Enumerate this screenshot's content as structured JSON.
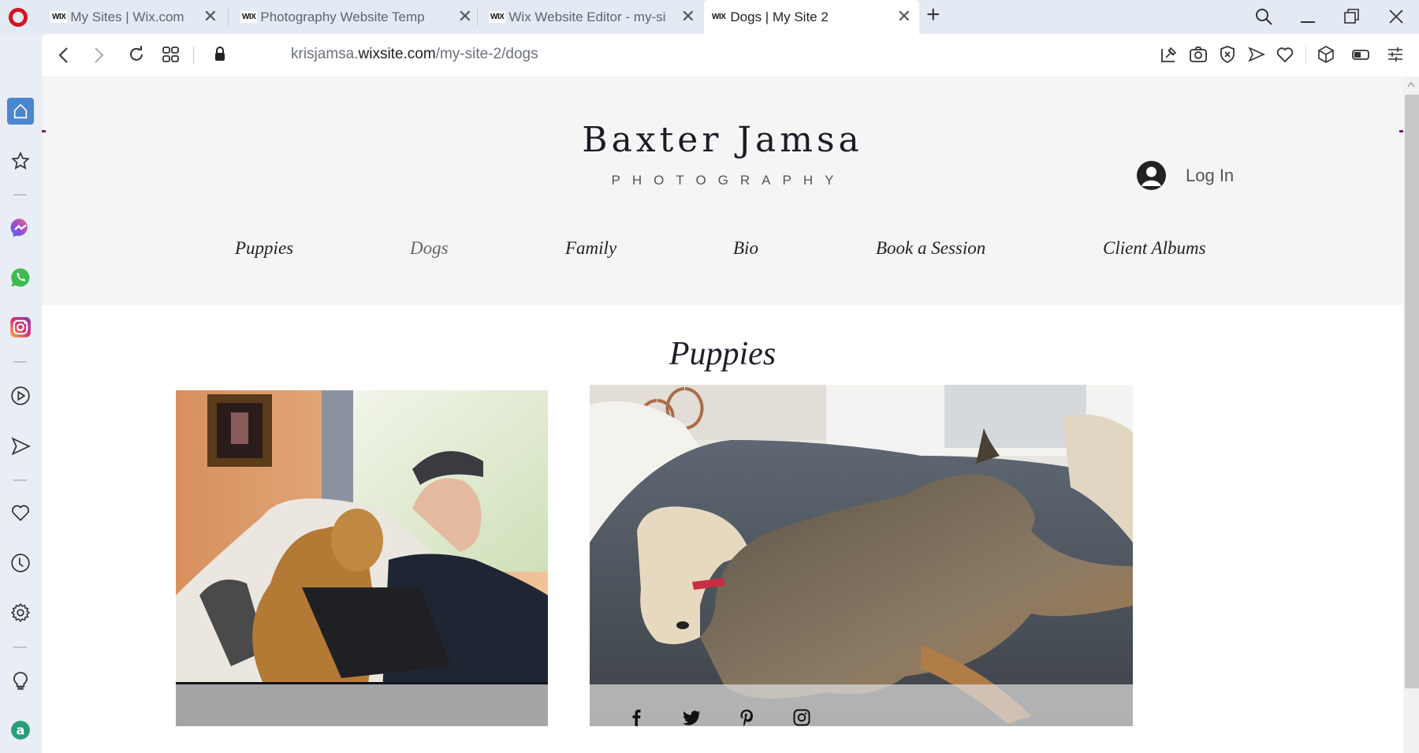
{
  "browser": {
    "tabs": [
      {
        "label": "My Sites | Wix.com",
        "favicon": "WIX",
        "active": false
      },
      {
        "label": "Photography Website Temp",
        "favicon": "WIX",
        "active": false
      },
      {
        "label": "Wix Website Editor - my-sit",
        "favicon": "WIX",
        "active": false
      },
      {
        "label": "Dogs | My Site 2",
        "favicon": "WIX",
        "active": true
      }
    ],
    "new_tab_label": "+",
    "close_glyph": "✕",
    "url_prefix": "krisjamsa.",
    "url_domain": "wixsite.com",
    "url_path": "/my-site-2/dogs",
    "toolbar_icons": [
      "snapshot-pin-icon",
      "camera-icon",
      "shield-block-icon",
      "send-icon",
      "heart-icon",
      "cube-icon",
      "battery-icon",
      "settings-sliders-icon"
    ],
    "sidebar_icons": [
      "home-icon",
      "star-icon",
      "messenger-icon",
      "whatsapp-icon",
      "instagram-icon",
      "player-icon",
      "send-icon",
      "heart-icon",
      "history-icon",
      "settings-icon",
      "lightbulb-icon",
      "aria-icon"
    ],
    "accent_color": "#4b86d0"
  },
  "site": {
    "brand_title": "Baxter Jamsa",
    "brand_subtitle": "PHOTOGRAPHY",
    "login_label": "Log In",
    "nav": [
      {
        "label": "Puppies",
        "active": false
      },
      {
        "label": "Dogs",
        "active": true
      },
      {
        "label": "Family",
        "active": false
      },
      {
        "label": "Bio",
        "active": false
      },
      {
        "label": "Book a Session",
        "active": false
      },
      {
        "label": "Client Albums",
        "active": false
      }
    ],
    "section_heading": "Puppies",
    "photos": [
      {
        "alt": "Dog sitting next to a man working on a laptop on a couch"
      },
      {
        "alt": "Fluffy puppy and German Shepherd sleeping on a gray comforter"
      }
    ],
    "social_icons": [
      "facebook-icon",
      "twitter-icon",
      "pinterest-icon",
      "instagram-icon"
    ]
  }
}
